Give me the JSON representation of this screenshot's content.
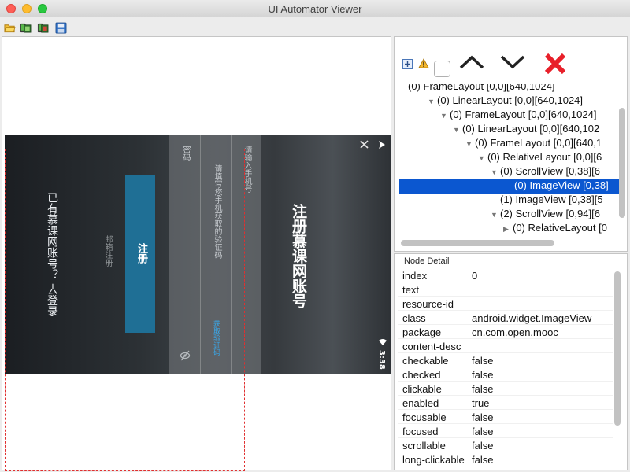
{
  "window": {
    "title": "UI Automator Viewer"
  },
  "toolbar": {
    "icons": [
      "open-folder-icon",
      "device-screenshot-icon",
      "device-screenshot-compressed-icon",
      "save-icon"
    ]
  },
  "device": {
    "status_time": "3:38",
    "page_title": "注册慕课网账号",
    "phone_hint": "请输入手机号",
    "code_hint": "请填写您手机获取的验证码",
    "password_hint": "密码",
    "get_code_label": "获取验证码",
    "register_button": "注册",
    "email_register": "邮箱注册",
    "login_prompt": "已有慕课网账号？ 去登录"
  },
  "tree": {
    "rows": [
      {
        "label": "(0) FrameLayout [0,0][640,1024]",
        "indent": 0,
        "arrow": ""
      },
      {
        "label": "(0) LinearLayout [0,0][640,1024]",
        "indent": 1,
        "arrow": "▼"
      },
      {
        "label": "(0) FrameLayout [0,0][640,1024]",
        "indent": 2,
        "arrow": "▼"
      },
      {
        "label": "(0) LinearLayout [0,0][640,102",
        "indent": 3,
        "arrow": "▼"
      },
      {
        "label": "(0) FrameLayout [0,0][640,1",
        "indent": 4,
        "arrow": "▼"
      },
      {
        "label": "(0) RelativeLayout [0,0][6",
        "indent": 5,
        "arrow": "▼"
      },
      {
        "label": "(0) ScrollView [0,38][6",
        "indent": 6,
        "arrow": "▼"
      },
      {
        "label": "(0) ImageView [0,38]",
        "indent": 7,
        "arrow": "",
        "selected": true
      },
      {
        "label": "(1) ImageView [0,38][5",
        "indent": 6,
        "arrow": ""
      },
      {
        "label": "(2) ScrollView [0,94][6",
        "indent": 6,
        "arrow": "▼"
      },
      {
        "label": "(0) RelativeLayout [0",
        "indent": 7,
        "arrow": "▶"
      }
    ]
  },
  "detail": {
    "title": "Node Detail",
    "rows": [
      {
        "key": "index",
        "value": "0"
      },
      {
        "key": "text",
        "value": ""
      },
      {
        "key": "resource-id",
        "value": ""
      },
      {
        "key": "class",
        "value": "android.widget.ImageView"
      },
      {
        "key": "package",
        "value": "cn.com.open.mooc"
      },
      {
        "key": "content-desc",
        "value": ""
      },
      {
        "key": "checkable",
        "value": "false"
      },
      {
        "key": "checked",
        "value": "false"
      },
      {
        "key": "clickable",
        "value": "false"
      },
      {
        "key": "enabled",
        "value": "true"
      },
      {
        "key": "focusable",
        "value": "false"
      },
      {
        "key": "focused",
        "value": "false"
      },
      {
        "key": "scrollable",
        "value": "false"
      },
      {
        "key": "long-clickable",
        "value": "false"
      }
    ]
  },
  "colors": {
    "selection": "#0b57d0",
    "delete": "#e8202a",
    "register_button": "#1f6f95"
  }
}
